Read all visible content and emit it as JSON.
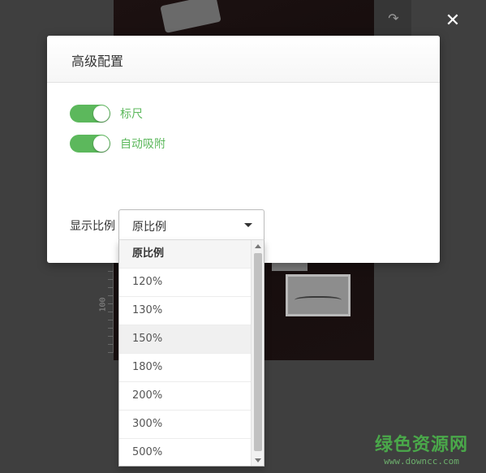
{
  "dialog": {
    "title": "高级配置",
    "toggles": [
      {
        "label": "标尺",
        "on": true
      },
      {
        "label": "自动吸附",
        "on": true
      }
    ],
    "ratio_label": "显示比例",
    "select": {
      "value": "原比例",
      "options": [
        "原比例",
        "120%",
        "130%",
        "150%",
        "180%",
        "200%",
        "300%",
        "500%"
      ],
      "hovered_option": "150%"
    },
    "close_icon": "close-icon",
    "accent_color": "#5cb85c"
  },
  "background": {
    "ruler_label": "100",
    "toolbar_icon": "redo-icon"
  },
  "watermark": {
    "title": "绿色资源网",
    "url": "www.downcc.com"
  }
}
